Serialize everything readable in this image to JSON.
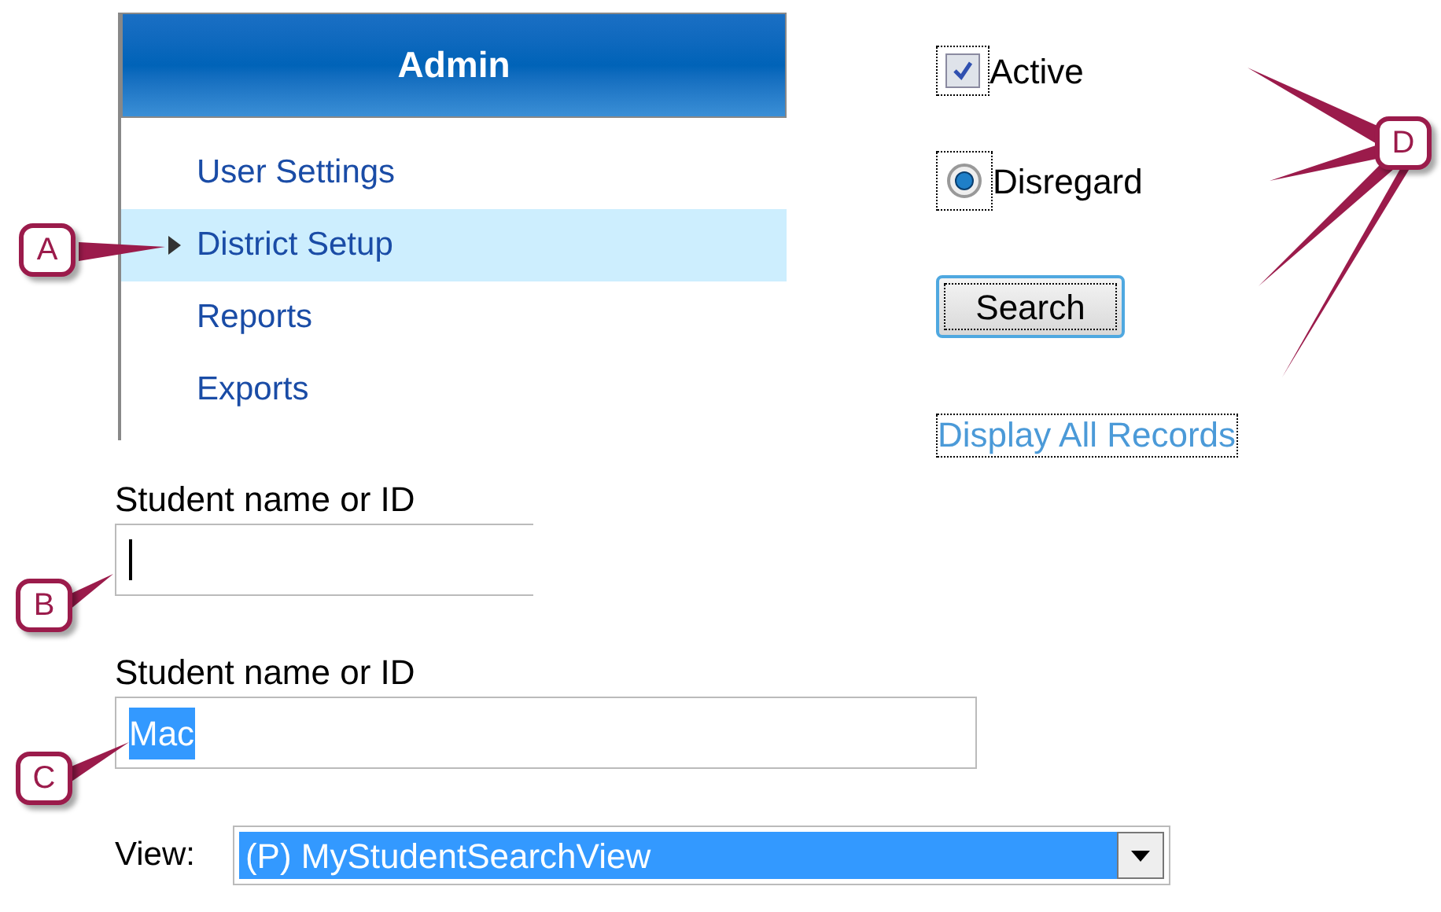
{
  "menu": {
    "title": "Admin",
    "items": [
      {
        "label": "User Settings",
        "selected": false
      },
      {
        "label": "District Setup",
        "selected": true
      },
      {
        "label": "Reports",
        "selected": false
      },
      {
        "label": "Exports",
        "selected": false
      }
    ]
  },
  "filters": {
    "checkbox": {
      "label": "Active",
      "checked": true
    },
    "radio": {
      "label": "Disregard",
      "selected": true
    },
    "button": "Search",
    "link": "Display All Records"
  },
  "fields": [
    {
      "label": "Student name or ID",
      "focused": true
    },
    {
      "label": "Student name or ID",
      "value": "Mac",
      "focused": false,
      "highlighted": true
    }
  ],
  "view": {
    "label": "View:",
    "value": "(P) MyStudentSearchView",
    "highlighted": true
  },
  "callouts": [
    {
      "letter": "A"
    },
    {
      "letter": "B"
    },
    {
      "letter": "C"
    },
    {
      "letter": "D"
    }
  ]
}
